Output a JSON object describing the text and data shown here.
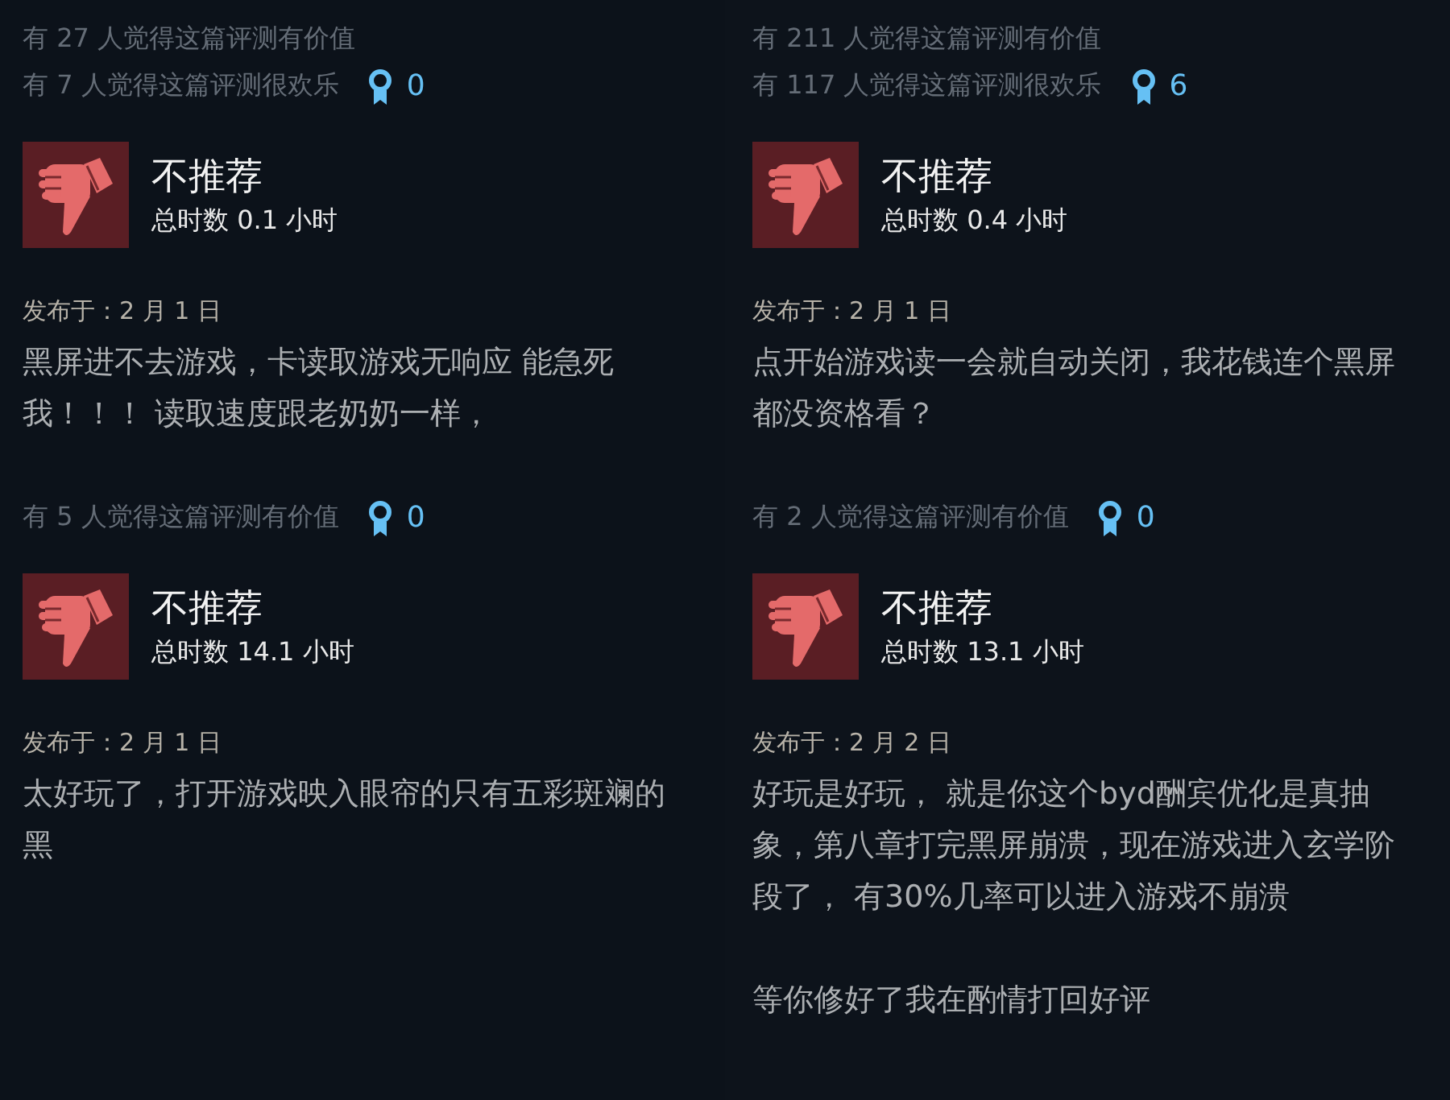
{
  "columns": [
    {
      "reviews": [
        {
          "votes": [
            "有 27 人觉得这篇评测有价值",
            "有 7 人觉得这篇评测很欢乐"
          ],
          "awards": "0",
          "verdict": {
            "kind": "not_recommended",
            "label": "不推荐"
          },
          "hours": "总时数 0.1 小时",
          "date": "发布于：2 月 1 日",
          "body": [
            "黑屏进不去游戏，卡读取游戏无响应 能急死我！！！ 读取速度跟老奶奶一样，"
          ]
        },
        {
          "votes": [
            "有 5 人觉得这篇评测有价值"
          ],
          "awards": "0",
          "verdict": {
            "kind": "not_recommended",
            "label": "不推荐"
          },
          "hours": "总时数 14.1 小时",
          "date": "发布于：2 月 1 日",
          "body": [
            "太好玩了，打开游戏映入眼帘的只有五彩斑斓的黑"
          ]
        }
      ]
    },
    {
      "reviews": [
        {
          "votes": [
            "有 211 人觉得这篇评测有价值",
            "有 117 人觉得这篇评测很欢乐"
          ],
          "awards": "6",
          "verdict": {
            "kind": "not_recommended",
            "label": "不推荐"
          },
          "hours": "总时数 0.4 小时",
          "date": "发布于：2 月 1 日",
          "body": [
            "点开始游戏读一会就自动关闭，我花钱连个黑屏都没资格看？"
          ]
        },
        {
          "votes": [
            "有 2 人觉得这篇评测有价值"
          ],
          "awards": "0",
          "verdict": {
            "kind": "not_recommended",
            "label": "不推荐"
          },
          "hours": "总时数 13.1 小时",
          "date": "发布于：2 月 2 日",
          "body": [
            "好玩是好玩， 就是你这个byd酬宾优化是真抽象，第八章打完黑屏崩溃，现在游戏进入玄学阶段了， 有30%几率可以进入游戏不崩溃",
            "等你修好了我在酌情打回好评"
          ]
        }
      ]
    }
  ]
}
